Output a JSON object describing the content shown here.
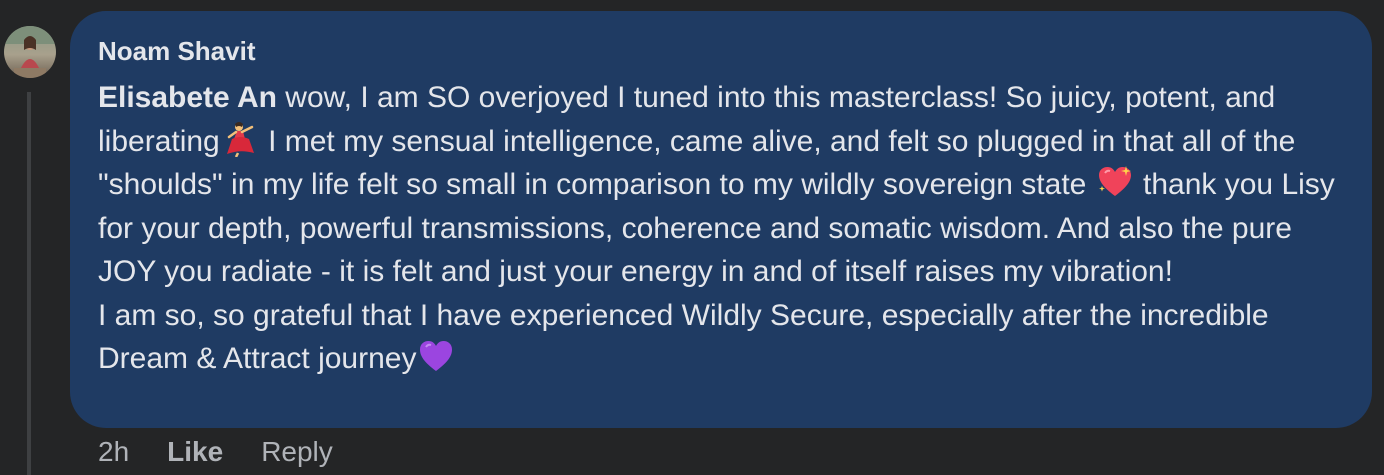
{
  "comment": {
    "author": "Noam Shavit",
    "mention": "Elisabete An",
    "text_part1": " wow, I am SO overjoyed I tuned into this masterclass! So juicy, potent, and liberating",
    "text_part2": " I met my sensual intelligence, came alive, and felt so plugged in that all of the \"shoulds\" in my life felt so small in comparison to my wildly sovereign state ",
    "text_part3": " thank you Lisy for your depth, powerful transmissions, coherence and somatic wisdom. And also the pure JOY you radiate - it is felt and just your energy in and of itself raises my vibration!",
    "text_part4": "I am so, so grateful that I have experienced Wildly Secure, especially after the incredible Dream & Attract journey",
    "emojis": [
      "dancer-emoji",
      "sparkling-heart-emoji",
      "purple-heart-emoji"
    ]
  },
  "actions": {
    "time": "2h",
    "like": "Like",
    "reply": "Reply"
  },
  "colors": {
    "page_bg": "#242526",
    "bubble_bg": "#1f3b63",
    "text": "#e4e6eb",
    "secondary_text": "#b0b3b8",
    "thread_line": "#3e4042"
  }
}
